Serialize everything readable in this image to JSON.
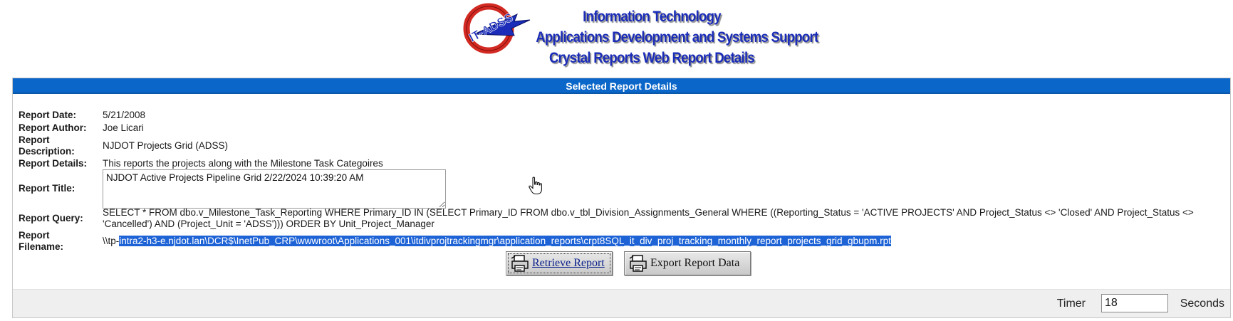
{
  "header": {
    "logo_text": "IT-ADSS",
    "line1": "Information Technology",
    "line2": "Applications Development and Systems Support",
    "line3": "Crystal Reports Web Report Details"
  },
  "panel": {
    "title": "Selected Report Details"
  },
  "fields": {
    "report_date": {
      "label": "Report Date:",
      "value": "5/21/2008"
    },
    "report_author": {
      "label": "Report Author:",
      "value": "Joe Licari"
    },
    "report_description": {
      "label": "Report Description:",
      "value": "NJDOT Projects Grid (ADSS)"
    },
    "report_details": {
      "label": "Report Details:",
      "value": "This reports the projects along with the Milestone Task Categoires"
    },
    "report_title": {
      "label": "Report Title:",
      "value": "NJDOT Active Projects Pipeline Grid 2/22/2024 10:39:20 AM"
    },
    "report_query": {
      "label": "Report Query:",
      "value": "SELECT * FROM dbo.v_Milestone_Task_Reporting WHERE Primary_ID IN (SELECT Primary_ID FROM dbo.v_tbl_Division_Assignments_General WHERE ((Reporting_Status = 'ACTIVE PROJECTS' AND Project_Status <> 'Closed' AND Project_Status <> 'Cancelled') AND (Project_Unit = 'ADSS'))) ORDER BY Unit_Project_Manager"
    },
    "report_filename": {
      "label": "Report Filename:",
      "value_unselected": "\\\\tp-",
      "value_selected": "intra2-h3-e.njdot.lan\\DCR$\\InetPub_CRP\\wwwroot\\Applications_001\\itdivprojtrackingmgr\\application_reports\\crpt8SQL_it_div_proj_tracking_monthly_report_projects_grid_gbupm.rpt"
    }
  },
  "buttons": {
    "retrieve_label": "Retrieve Report",
    "export_label": "Export Report Data"
  },
  "footer": {
    "timer_label": "Timer",
    "timer_value": "18",
    "seconds_label": "Seconds"
  },
  "colors": {
    "title_bar": "#0a66c8",
    "header_text": "#1a2cb8",
    "selection": "#1e63d6"
  },
  "icons": [
    "it-adss-logo-icon",
    "printer-icon",
    "pointer-hand-cursor-icon"
  ]
}
